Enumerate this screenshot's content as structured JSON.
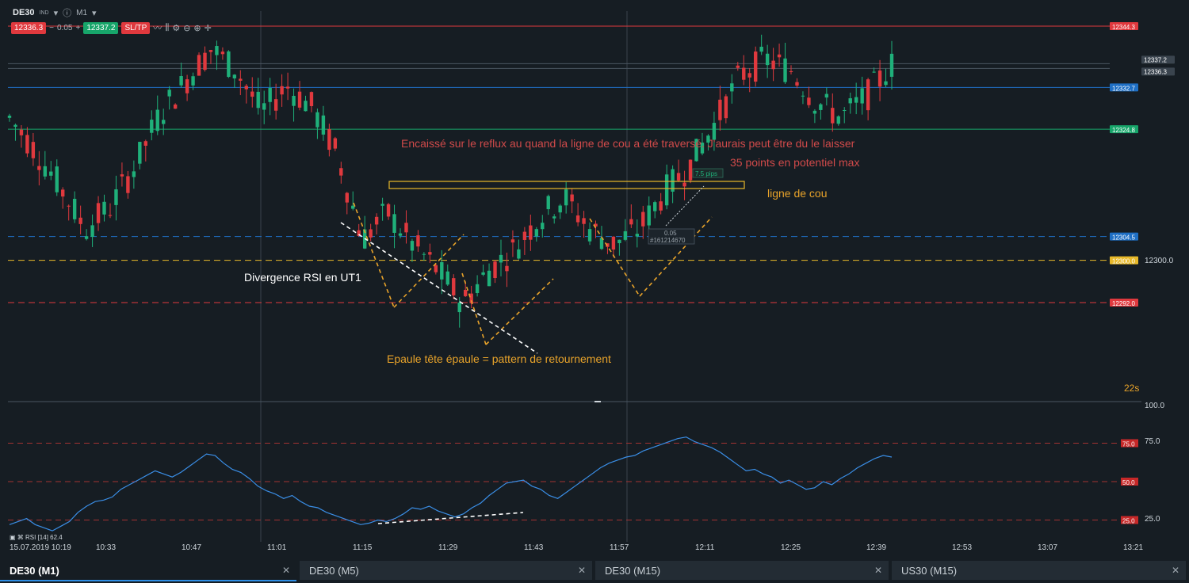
{
  "toolbar": {
    "symbol": "DE30",
    "symbol_tag": "IND",
    "timeframe": "M1",
    "bid": "12336.3",
    "spread": "0.05",
    "ask": "12337.2",
    "sltp_label": "SL/TP"
  },
  "tabs": [
    {
      "label": "DE30 (M1)",
      "active": true
    },
    {
      "label": "DE30 (M5)",
      "active": false
    },
    {
      "label": "DE30 (M15)",
      "active": false
    },
    {
      "label": "US30 (M15)",
      "active": false
    }
  ],
  "colors": {
    "bg": "#161d23",
    "bull": "#1fb07a",
    "bear": "#e0393e",
    "orange": "#e8a32a",
    "rsi": "#3a8ee6"
  },
  "chart_data": [
    {
      "type": "candlestick",
      "title": "DE30 (M1)",
      "x_ticks": [
        "15.07.2019 10:19",
        "10:33",
        "10:47",
        "11:01",
        "11:15",
        "11:29",
        "11:43",
        "11:57",
        "12:11",
        "12:25",
        "12:39",
        "12:53",
        "13:07",
        "13:21"
      ],
      "ohlc_sample": [
        [
          12334,
          12338,
          12322,
          12327
        ],
        [
          12327,
          12330,
          12318,
          12321
        ],
        [
          12321,
          12324,
          12312,
          12314
        ],
        [
          12314,
          12318,
          12302,
          12306
        ],
        [
          12306,
          12312,
          12298,
          12310
        ],
        [
          12310,
          12320,
          12308,
          12318
        ],
        [
          12318,
          12330,
          12315,
          12328
        ],
        [
          12328,
          12336,
          12325,
          12334
        ],
        [
          12334,
          12342,
          12330,
          12340
        ],
        [
          12340,
          12346,
          12333,
          12336
        ],
        [
          12336,
          12340,
          12324,
          12328
        ],
        [
          12328,
          12335,
          12325,
          12333
        ],
        [
          12333,
          12338,
          12326,
          12329
        ],
        [
          12329,
          12333,
          12318,
          12320
        ],
        [
          12320,
          12322,
          12300,
          12304
        ],
        [
          12304,
          12311,
          12298,
          12309
        ],
        [
          12309,
          12313,
          12300,
          12303
        ],
        [
          12303,
          12306,
          12294,
          12298
        ],
        [
          12298,
          12302,
          12289,
          12292
        ],
        [
          12292,
          12300,
          12290,
          12298
        ],
        [
          12298,
          12305,
          12295,
          12302
        ],
        [
          12302,
          12310,
          12300,
          12308
        ],
        [
          12308,
          12315,
          12305,
          12312
        ],
        [
          12312,
          12314,
          12304,
          12306
        ],
        [
          12306,
          12310,
          12300,
          12303
        ],
        [
          12303,
          12308,
          12299,
          12306
        ],
        [
          12306,
          12314,
          12304,
          12313
        ],
        [
          12313,
          12320,
          12311,
          12318
        ],
        [
          12318,
          12328,
          12316,
          12326
        ],
        [
          12326,
          12337,
          12324,
          12335
        ],
        [
          12335,
          12342,
          12332,
          12338
        ],
        [
          12338,
          12341,
          12333,
          12336
        ],
        [
          12336,
          12339,
          12328,
          12330
        ],
        [
          12330,
          12334,
          12325,
          12327
        ],
        [
          12327,
          12333,
          12324,
          12331
        ],
        [
          12331,
          12339,
          12328,
          12337
        ]
      ],
      "price_levels": [
        {
          "label": "12344.3",
          "value": 12344.3,
          "color": "#e0393e",
          "style": "solid"
        },
        {
          "label": "12337.2",
          "value": 12337.2,
          "color": "#4a5561",
          "style": "solid"
        },
        {
          "label": "12336.3",
          "value": 12336.3,
          "color": "#4a5561",
          "style": "solid"
        },
        {
          "label": "12332.7",
          "value": 12332.7,
          "color": "#1f6fc4",
          "style": "solid"
        },
        {
          "label": "12324.8",
          "value": 12324.8,
          "color": "#17a56a",
          "style": "solid"
        },
        {
          "label": "12304.5",
          "value": 12304.5,
          "color": "#1f6fc4",
          "style": "dashed"
        },
        {
          "label": "12300.0",
          "value": 12300.0,
          "color": "#e8b92a",
          "style": "dashed"
        },
        {
          "label": "12292.0",
          "value": 12292.0,
          "color": "#e0393e",
          "style": "dashed"
        }
      ],
      "right_axis_labels": [
        "12300.0"
      ],
      "annotations": [
        {
          "text": "Encaissé sur le reflux au quand la ligne de cou a été traversé. J'aurais peut être du le laisser",
          "color": "#d04a4a"
        },
        {
          "text": "35 points en potentiel max",
          "color": "#d04a4a"
        },
        {
          "text": "ligne de cou",
          "color": "#e8a32a"
        },
        {
          "text": "Divergence RSI en UT1",
          "color": "#ffffff"
        },
        {
          "text": "Epaule tête épaule = pattern de retournement",
          "color": "#e8a32a"
        }
      ],
      "trade_marks": [
        "7.5 pips",
        "0.05",
        "#161214670"
      ],
      "timer": "22s"
    },
    {
      "type": "line",
      "title": "RSI [14] 62.4",
      "indicator_label": "RSI [14] 62.4",
      "ylim": [
        0,
        100
      ],
      "y_axis_labels": [
        "100.0",
        "75.0",
        "25.0"
      ],
      "levels": [
        {
          "label": "75.0",
          "value": 75
        },
        {
          "label": "50.0",
          "value": 50
        },
        {
          "label": "25.0",
          "value": 25
        }
      ],
      "values": [
        22,
        24,
        26,
        22,
        20,
        18,
        21,
        24,
        30,
        34,
        37,
        38,
        40,
        45,
        48,
        51,
        54,
        57,
        55,
        53,
        56,
        60,
        64,
        68,
        67,
        62,
        58,
        56,
        52,
        47,
        44,
        42,
        39,
        41,
        37,
        34,
        33,
        30,
        28,
        26,
        24,
        22,
        23,
        25,
        24,
        26,
        29,
        33,
        32,
        34,
        31,
        29,
        27,
        29,
        33,
        36,
        41,
        45,
        49,
        50,
        51,
        47,
        45,
        41,
        39,
        43,
        47,
        51,
        55,
        59,
        62,
        64,
        66,
        67,
        70,
        72,
        74,
        76,
        78,
        79,
        76,
        74,
        72,
        69,
        65,
        61,
        57,
        58,
        55,
        53,
        49,
        51,
        48,
        45,
        46,
        50,
        48,
        52,
        55,
        59,
        62,
        65,
        67,
        66
      ]
    }
  ]
}
